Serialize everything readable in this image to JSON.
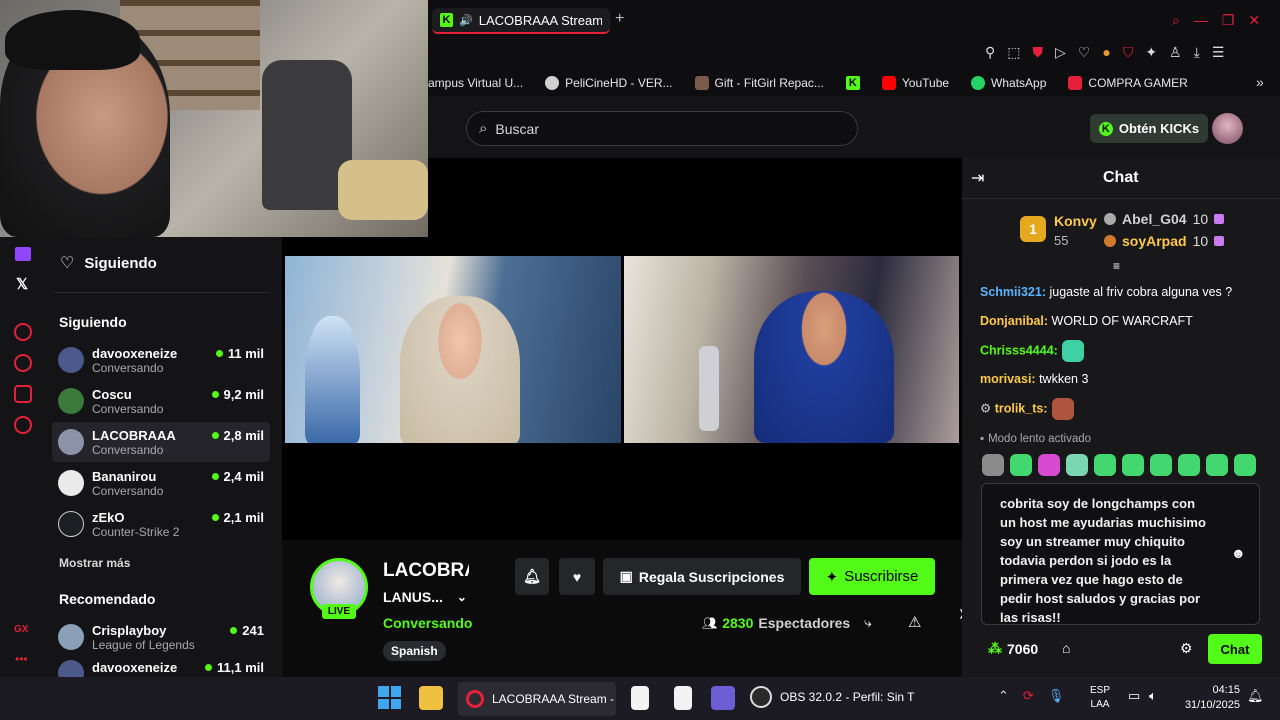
{
  "browser": {
    "tab_title": "LACOBRAAA Stream -",
    "new_tab": "+",
    "bookmarks": [
      {
        "label": "ampus Virtual U...",
        "color": "#3b6fcf"
      },
      {
        "label": "PeliCineHD - VER...",
        "color": "#cfcfcf"
      },
      {
        "label": "Gift - FitGirl Repac...",
        "color": "#7a5a4a"
      },
      {
        "label": "",
        "color": "#53fc18"
      },
      {
        "label": "YouTube",
        "color": "#ff0000"
      },
      {
        "label": "WhatsApp",
        "color": "#25d366"
      },
      {
        "label": "COMPRA GAMER",
        "color": "#e5203a"
      }
    ]
  },
  "header": {
    "search_placeholder": "Buscar",
    "kicks_label": "Obtén KICKs"
  },
  "sidebar": {
    "following_title": "Siguiendo",
    "section_following": "Siguiendo",
    "following": [
      {
        "name": "davooxeneize",
        "sub": "Conversando",
        "count": "11 mil",
        "color": "#4b5a8a"
      },
      {
        "name": "Coscu",
        "sub": "Conversando",
        "count": "9,2 mil",
        "color": "#3b7a3b"
      },
      {
        "name": "LACOBRAAA",
        "sub": "Conversando",
        "count": "2,8 mil",
        "color": "#8c92a8"
      },
      {
        "name": "Bananirou",
        "sub": "Conversando",
        "count": "2,4 mil",
        "color": "#eaeaea"
      },
      {
        "name": "zEkO",
        "sub": "Counter-Strike 2",
        "count": "2,1 mil",
        "color": "#1d1d24"
      }
    ],
    "show_more": "Mostrar más",
    "section_recommended": "Recomendado",
    "recommended": [
      {
        "name": "Crisplayboy",
        "sub": "League of Legends",
        "count": "241",
        "color": "#8aa0b6"
      },
      {
        "name": "davooxeneize",
        "sub": "",
        "count": "11,1 mil",
        "color": "#4b5a8a"
      }
    ]
  },
  "stream": {
    "channel": "LACOBRA",
    "title": "LANUS...",
    "category": "Conversando",
    "language_tag": "Spanish",
    "live_badge": "LIVE",
    "gift_label": "Regala Suscripciones",
    "subscribe_label": "Suscribirse",
    "viewers": "2830",
    "viewers_label": "Espectadores"
  },
  "chat": {
    "title": "Chat",
    "leader": {
      "name": "Konvy",
      "score": "55",
      "rank": "1"
    },
    "leader2": {
      "name": "Abel_G04",
      "score": "10",
      "rank": "2"
    },
    "leader3": {
      "name": "soyArpad",
      "score": "10",
      "rank": "3"
    },
    "messages": [
      {
        "user": "Schmii321:",
        "text": " jugaste al friv cobra alguna ves ?",
        "color": "#5ab3ff"
      },
      {
        "user": "Donjanibal:",
        "text": " WORLD OF WARCRAFT",
        "color": "#ffc94a"
      },
      {
        "user": "Chrisss4444:",
        "text": "",
        "color": "#53fc18"
      },
      {
        "user": "morivasi:",
        "text": " twkken 3",
        "color": "#ffc94a"
      },
      {
        "user": "trolik_ts:",
        "text": "",
        "color": "#ffc94a"
      }
    ],
    "slow_mode": "Modo lento activado",
    "input_text": "cobrita soy de longchamps con un host me ayudarias muchisimo soy un streamer muy chiquito todavia perdon si jodo es la primera vez que hago esto de pedir host saludos y gracias por las risas!!",
    "points": "7060",
    "send_label": "Chat"
  },
  "taskbar": {
    "app1": "LACOBRAAA Stream - W",
    "app2": "OBS 32.0.2 - Perfil: Sin T",
    "lang": "ESP",
    "lang2": "LAA",
    "time": "04:15",
    "date": "31/10/2025"
  }
}
